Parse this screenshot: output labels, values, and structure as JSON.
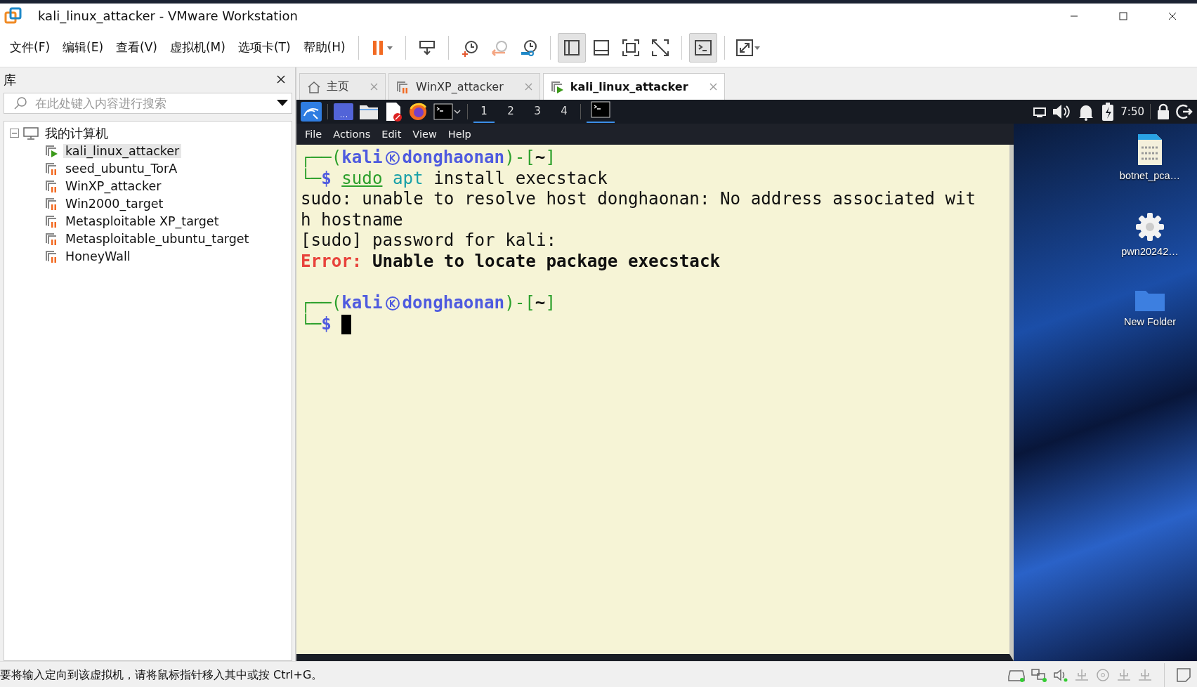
{
  "window": {
    "title": "kali_linux_attacker - VMware Workstation"
  },
  "menu": [
    "文件(F)",
    "编辑(E)",
    "查看(V)",
    "虚拟机(M)",
    "选项卡(T)",
    "帮助(H)"
  ],
  "toolbar": [
    {
      "kind": "pause",
      "pressed": false
    },
    {
      "kind": "send-keys",
      "pressed": false
    },
    {
      "kind": "snapshot",
      "pressed": false
    },
    {
      "kind": "revert",
      "pressed": false
    },
    {
      "kind": "snapshot-manager",
      "pressed": false
    },
    {
      "kind": "library-view",
      "pressed": true
    },
    {
      "kind": "thumbnail-view",
      "pressed": false
    },
    {
      "kind": "fullscreen",
      "pressed": false
    },
    {
      "kind": "unity",
      "pressed": false
    },
    {
      "kind": "console",
      "pressed": true
    },
    {
      "kind": "stretch",
      "pressed": false
    }
  ],
  "sidebar": {
    "title": "库",
    "search": {
      "placeholder": "在此处键入内容进行搜索"
    },
    "tree": [
      {
        "label": "我的计算机",
        "expanded": true,
        "children": [
          {
            "label": "kali_linux_attacker",
            "running": true,
            "selected": true
          },
          {
            "label": "seed_ubuntu_TorA",
            "running": false,
            "selected": false
          },
          {
            "label": "WinXP_attacker",
            "running": false,
            "selected": false
          },
          {
            "label": "Win2000_target",
            "running": false,
            "selected": false
          },
          {
            "label": "Metasploitable XP_target",
            "running": false,
            "selected": false
          },
          {
            "label": "Metasploitable_ubuntu_target",
            "running": false,
            "selected": false
          },
          {
            "label": "HoneyWall",
            "running": false,
            "selected": false
          }
        ]
      }
    ]
  },
  "tabs": [
    {
      "label": "主页",
      "kind": "home",
      "selected": false
    },
    {
      "label": "WinXP_attacker",
      "kind": "vm-suspended",
      "selected": false
    },
    {
      "label": "kali_linux_attacker",
      "kind": "vm-running",
      "selected": true
    }
  ],
  "guest": {
    "panel": {
      "workspaces": [
        {
          "label": "1",
          "selected": true
        },
        {
          "label": "2",
          "selected": false
        },
        {
          "label": "3",
          "selected": false
        },
        {
          "label": "4",
          "selected": false
        }
      ],
      "clock": "7:50"
    },
    "terminal": {
      "menu": [
        "File",
        "Actions",
        "Edit",
        "View",
        "Help"
      ],
      "lines": [
        {
          "kind": "prompt",
          "parts": [
            "┌──(",
            "kali",
            "donghaonan",
            ")-[",
            "~",
            "]"
          ]
        },
        {
          "kind": "command",
          "parts": [
            "└─",
            "$",
            "sudo",
            "apt",
            "install execstack"
          ]
        },
        {
          "kind": "output",
          "text": "sudo: unable to resolve host donghaonan: No address associated wit"
        },
        {
          "kind": "output",
          "text": "h hostname"
        },
        {
          "kind": "output",
          "text": "[sudo] password for kali:"
        },
        {
          "kind": "error",
          "parts": [
            "Error:",
            "Unable to locate package execstack"
          ]
        },
        {
          "kind": "blank"
        },
        {
          "kind": "prompt",
          "parts": [
            "┌──(",
            "kali",
            "donghaonan",
            ")-[",
            "~",
            "]"
          ]
        },
        {
          "kind": "input",
          "parts": [
            "└─",
            "$"
          ]
        }
      ]
    },
    "desktop": [
      {
        "label": "botnet_pca…",
        "kind": "binary-file"
      },
      {
        "label": "pwn20242…",
        "kind": "executable"
      },
      {
        "label": "New Folder",
        "kind": "folder"
      }
    ]
  },
  "status_bar": {
    "text": "要将输入定向到该虚拟机，请将鼠标指针移入其中或按 Ctrl+G。"
  }
}
